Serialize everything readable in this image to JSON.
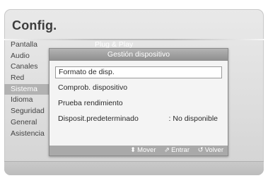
{
  "screen": {
    "title": "Config."
  },
  "sidebar": {
    "items": [
      {
        "label": "Pantalla"
      },
      {
        "label": "Audio"
      },
      {
        "label": "Canales"
      },
      {
        "label": "Red"
      },
      {
        "label": "Sistema",
        "active": true
      },
      {
        "label": "Idioma"
      },
      {
        "label": "Seguridad"
      },
      {
        "label": "General"
      },
      {
        "label": "Asistencia"
      }
    ]
  },
  "header_value": "Plug & Play",
  "dialog": {
    "title": "Gestión dispositivo",
    "items": [
      {
        "label": "Formato de disp.",
        "value": "",
        "selected": true
      },
      {
        "label": "Comprob. dispositivo",
        "value": ""
      },
      {
        "label": "Prueba rendimiento",
        "value": ""
      },
      {
        "label": "Disposit.predeterminado",
        "value": ": No disponible"
      }
    ],
    "footer": {
      "move": {
        "icon": "up-down-arrow-icon",
        "glyph": "⬍",
        "label": "Mover"
      },
      "enter": {
        "icon": "enter-icon",
        "glyph": "⇗",
        "label": "Entrar"
      },
      "back": {
        "icon": "return-icon",
        "glyph": "↺",
        "label": "Volver"
      }
    }
  },
  "colors": {
    "active_item_bg": "#b2b2b2",
    "dialog_header_bg": "#9e9e9e",
    "footer_bg": "#a9a9a9"
  }
}
